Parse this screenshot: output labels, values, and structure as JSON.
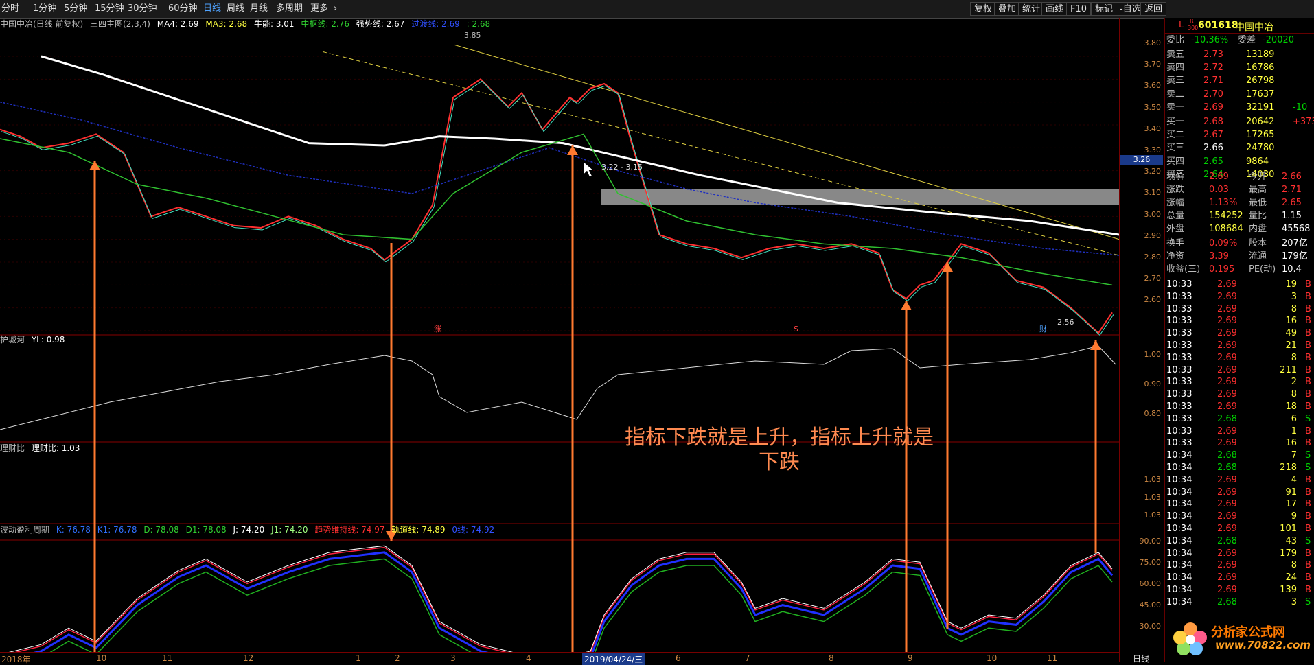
{
  "toolbar": {
    "periods": [
      "分时",
      "1分钟",
      "5分钟",
      "15分钟",
      "30分钟",
      "60分钟",
      "日线",
      "周线",
      "月线",
      "多周期",
      "更多"
    ],
    "active_period": "日线",
    "right_buttons": [
      "复权",
      "叠加",
      "统计",
      "画线",
      "F10",
      "标记",
      "-自选",
      "返回"
    ]
  },
  "main_legend": {
    "title": "中国中冶(日线 前复权)",
    "indicator": "三四主图(2,3,4)",
    "ma4": "MA4: 2.69",
    "ma3": "MA3: 2.68",
    "niuneng": "牛能: 3.01",
    "zhongshu": "中枢线: 2.76",
    "qiangshi": "强势线: 2.67",
    "guodu": "过渡线: 2.69",
    "extra": ": 2.68"
  },
  "annotations": {
    "peak": "3.85",
    "gap": "3.22 - 3.15",
    "low": "2.56",
    "mark_zhang": "涨",
    "mark_s": "S",
    "mark_cai": "财",
    "current_price_tag": "3.26"
  },
  "sub1_legend": {
    "name": "护城河",
    "value": "YL: 0.98"
  },
  "sub2_legend": {
    "name": "理财比",
    "value": "理财比: 1.03"
  },
  "sub3_legend": {
    "name": "波动盈利周期",
    "k": "K: 76.78",
    "k1": "K1: 76.78",
    "d": "D: 78.08",
    "d1": "D1: 78.08",
    "j": "J: 74.20",
    "j1": "J1: 74.20",
    "trend": "趋势维持线: 74.97",
    "track": "轨道线: 74.89",
    "extra": "0线: 74.92"
  },
  "price_scale": [
    "3.80",
    "3.70",
    "3.60",
    "3.50",
    "3.40",
    "3.30",
    "3.20",
    "3.10",
    "3.00",
    "2.90",
    "2.80",
    "2.70",
    "2.60"
  ],
  "sub1_scale": [
    "1.00",
    "0.90",
    "0.80"
  ],
  "sub2_scale": [
    "1.03",
    "1.03",
    "1.03"
  ],
  "sub3_scale": [
    "90.00",
    "75.00",
    "60.00",
    "45.00",
    "30.00"
  ],
  "date_axis": {
    "labels": [
      "2018年",
      "10",
      "11",
      "12",
      "1",
      "2",
      "3",
      "4",
      "2019/04/24/三",
      "6",
      "7",
      "8",
      "9",
      "10",
      "11"
    ],
    "right_label": "日线"
  },
  "caption": "指标下跌就是上升，指标上升就是下跌",
  "quote": {
    "code": "601618",
    "name": "中国中冶",
    "badge_top": "R",
    "badge_bottom": "300",
    "L": "L",
    "webi_label": "委比",
    "webi_value": "-10.36%",
    "weicha_label": "委差",
    "weicha_value": "-20020",
    "sells": [
      {
        "label": "卖五",
        "price": "2.73",
        "vol": "13189"
      },
      {
        "label": "卖四",
        "price": "2.72",
        "vol": "16786"
      },
      {
        "label": "卖三",
        "price": "2.71",
        "vol": "26798"
      },
      {
        "label": "卖二",
        "price": "2.70",
        "vol": "17637"
      },
      {
        "label": "卖一",
        "price": "2.69",
        "vol": "32191",
        "chg": "-10"
      }
    ],
    "buys": [
      {
        "label": "买一",
        "price": "2.68",
        "vol": "20642",
        "chg": "+373"
      },
      {
        "label": "买二",
        "price": "2.67",
        "vol": "17265"
      },
      {
        "label": "买三",
        "price": "2.66",
        "vol": "24780"
      },
      {
        "label": "买四",
        "price": "2.65",
        "vol": "9864"
      },
      {
        "label": "买五",
        "price": "2.64",
        "vol": "14030"
      }
    ],
    "stats": [
      {
        "l1": "现价",
        "v1": "2.69",
        "l2": "今开",
        "v2": "2.66"
      },
      {
        "l1": "涨跌",
        "v1": "0.03",
        "l2": "最高",
        "v2": "2.71"
      },
      {
        "l1": "涨幅",
        "v1": "1.13%",
        "l2": "最低",
        "v2": "2.65"
      },
      {
        "l1": "总量",
        "v1": "154252",
        "l2": "量比",
        "v2": "1.15"
      },
      {
        "l1": "外盘",
        "v1": "108684",
        "l2": "内盘",
        "v2": "45568"
      }
    ],
    "stats2": [
      {
        "l1": "换手",
        "v1": "0.09%",
        "l2": "股本",
        "v2": "207亿"
      },
      {
        "l1": "净资",
        "v1": "3.39",
        "l2": "流通",
        "v2": "179亿"
      },
      {
        "l1": "收益(三)",
        "v1": "0.195",
        "l2": "PE(动)",
        "v2": "10.4"
      }
    ],
    "ticks": [
      {
        "t": "10:33",
        "p": "2.69",
        "v": "19",
        "s": "B"
      },
      {
        "t": "10:33",
        "p": "2.69",
        "v": "3",
        "s": "B"
      },
      {
        "t": "10:33",
        "p": "2.69",
        "v": "8",
        "s": "B"
      },
      {
        "t": "10:33",
        "p": "2.69",
        "v": "16",
        "s": "B"
      },
      {
        "t": "10:33",
        "p": "2.69",
        "v": "49",
        "s": "B"
      },
      {
        "t": "10:33",
        "p": "2.69",
        "v": "21",
        "s": "B"
      },
      {
        "t": "10:33",
        "p": "2.69",
        "v": "8",
        "s": "B"
      },
      {
        "t": "10:33",
        "p": "2.69",
        "v": "211",
        "s": "B"
      },
      {
        "t": "10:33",
        "p": "2.69",
        "v": "2",
        "s": "B"
      },
      {
        "t": "10:33",
        "p": "2.69",
        "v": "8",
        "s": "B"
      },
      {
        "t": "10:33",
        "p": "2.69",
        "v": "18",
        "s": "B"
      },
      {
        "t": "10:33",
        "p": "2.68",
        "v": "6",
        "s": "S"
      },
      {
        "t": "10:33",
        "p": "2.69",
        "v": "1",
        "s": "B"
      },
      {
        "t": "10:33",
        "p": "2.69",
        "v": "16",
        "s": "B"
      },
      {
        "t": "10:34",
        "p": "2.68",
        "v": "7",
        "s": "S"
      },
      {
        "t": "10:34",
        "p": "2.68",
        "v": "218",
        "s": "S"
      },
      {
        "t": "10:34",
        "p": "2.69",
        "v": "4",
        "s": "B"
      },
      {
        "t": "10:34",
        "p": "2.69",
        "v": "91",
        "s": "B"
      },
      {
        "t": "10:34",
        "p": "2.69",
        "v": "17",
        "s": "B"
      },
      {
        "t": "10:34",
        "p": "2.69",
        "v": "9",
        "s": "B"
      },
      {
        "t": "10:34",
        "p": "2.69",
        "v": "101",
        "s": "B"
      },
      {
        "t": "10:34",
        "p": "2.68",
        "v": "43",
        "s": "S"
      },
      {
        "t": "10:34",
        "p": "2.69",
        "v": "179",
        "s": "B"
      },
      {
        "t": "10:34",
        "p": "2.69",
        "v": "8",
        "s": "B"
      },
      {
        "t": "10:34",
        "p": "2.69",
        "v": "24",
        "s": "B"
      },
      {
        "t": "10:34",
        "p": "2.69",
        "v": "139",
        "s": "B"
      },
      {
        "t": "10:34",
        "p": "2.68",
        "v": "3",
        "s": "S"
      }
    ]
  },
  "watermark": {
    "site": "分析家公式网",
    "url": "www.70822.com"
  }
}
